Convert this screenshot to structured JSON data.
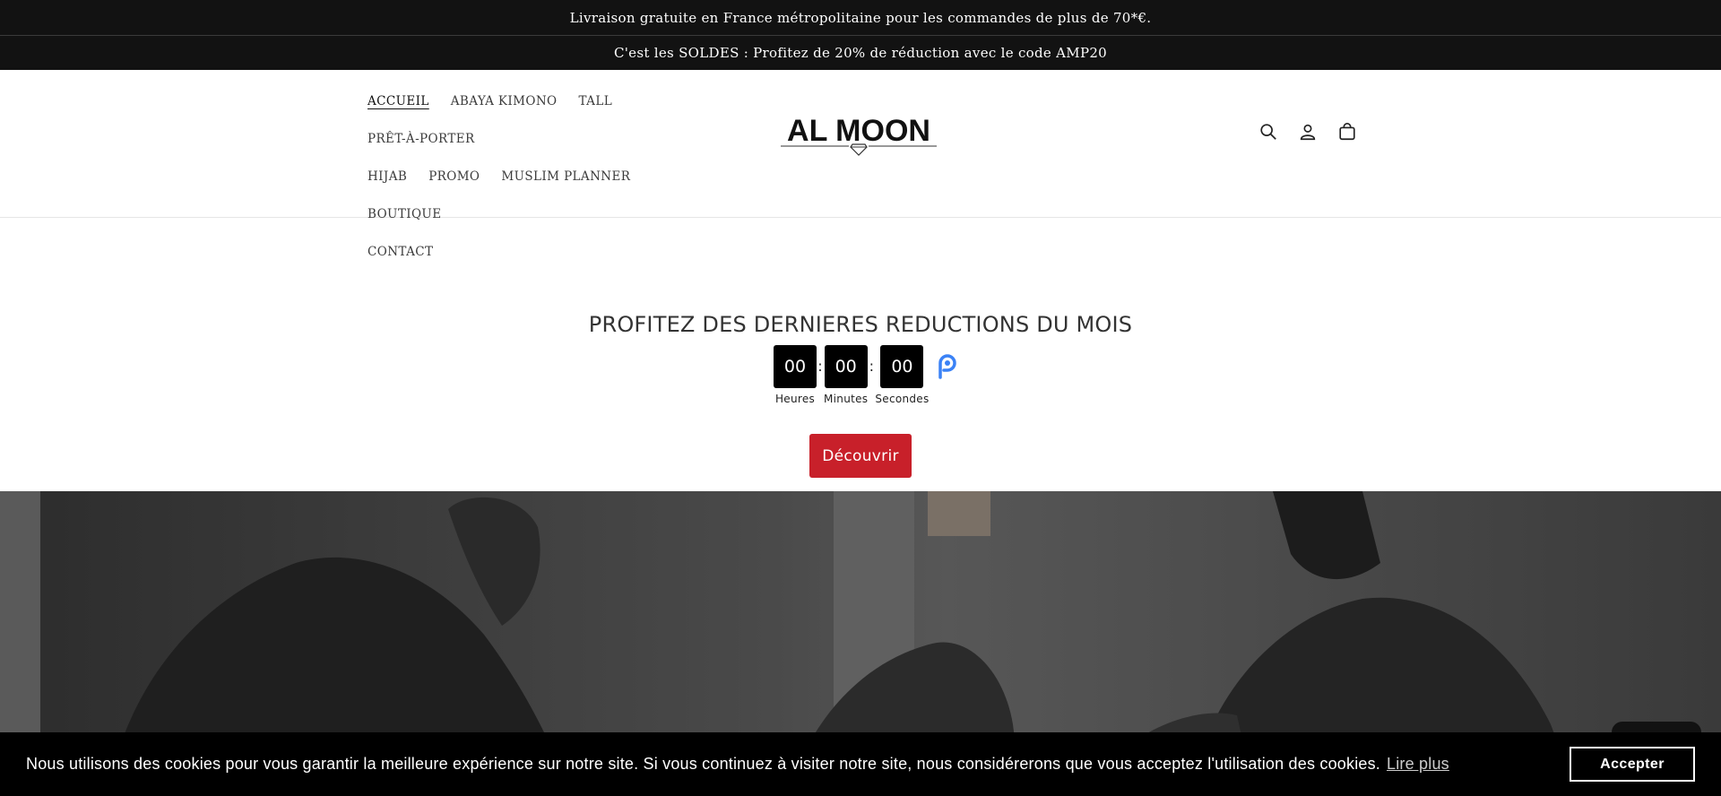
{
  "announcements": [
    "Livraison gratuite en France métropolitaine pour les commandes de plus de 70*€.",
    "C'est les SOLDES : Profitez de 20% de réduction avec le code AMP20"
  ],
  "nav": {
    "items": [
      {
        "label": "ACCUEIL",
        "active": true
      },
      {
        "label": "ABAYA KIMONO"
      },
      {
        "label": "TALL"
      },
      {
        "label": "PRÊT-À-PORTER"
      },
      {
        "label": "HIJAB"
      },
      {
        "label": "PROMO"
      },
      {
        "label": "MUSLIM PLANNER"
      },
      {
        "label": "BOUTIQUE"
      },
      {
        "label": "CONTACT"
      }
    ]
  },
  "logo": {
    "text": "AL MOON"
  },
  "header_icons": [
    "search-icon",
    "account-icon",
    "cart-icon"
  ],
  "promo": {
    "title": "PROFITEZ DES DERNIERES REDUCTIONS DU MOIS",
    "countdown": [
      {
        "value": "00",
        "label": "Heures"
      },
      {
        "value": "00",
        "label": "Minutes"
      },
      {
        "value": "00",
        "label": "Secondes"
      }
    ],
    "separator": ":",
    "button_label": "Découvrir"
  },
  "cookie": {
    "message": "Nous utilisons des cookies pour vous garantir la meilleure expérience sur notre site. Si vous continuez à visiter notre site, nous considérerons que vous acceptez l'utilisation des cookies.",
    "more_label": "Lire plus",
    "accept_label": "Accepter"
  },
  "colors": {
    "announcement_bg": "#121212",
    "cta_bg": "#c8202a",
    "cookie_bg": "#000000"
  }
}
